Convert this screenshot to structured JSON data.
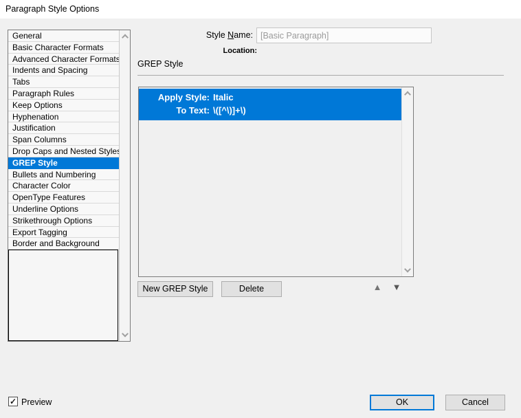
{
  "window": {
    "title": "Paragraph Style Options"
  },
  "colors": {
    "accent": "#0078d7",
    "selection_text": "#ffffff",
    "dialog_bg": "#f0f0f0",
    "titlebar_bg": "#ffffff",
    "button_bg": "#e1e1e1"
  },
  "sidebar": {
    "items": [
      "General",
      "Basic Character Formats",
      "Advanced Character Formats",
      "Indents and Spacing",
      "Tabs",
      "Paragraph Rules",
      "Keep Options",
      "Hyphenation",
      "Justification",
      "Span Columns",
      "Drop Caps and Nested Styles",
      "GREP Style",
      "Bullets and Numbering",
      "Character Color",
      "OpenType Features",
      "Underline Options",
      "Strikethrough Options",
      "Export Tagging",
      "Border and Background"
    ],
    "selected_index": 11
  },
  "header": {
    "style_name_label": {
      "pre": "Style ",
      "mnemonic": "N",
      "post": "ame:"
    },
    "style_name_value": "[Basic Paragraph]",
    "location_label": "Location:"
  },
  "panel": {
    "title": "GREP Style",
    "grep_styles": [
      {
        "selected": true,
        "lines": [
          {
            "label": "Apply Style:",
            "value": "Italic"
          },
          {
            "label": "To Text:",
            "value": "\\([^\\)]+\\)"
          }
        ]
      }
    ],
    "buttons": {
      "new_grep_style": "New GREP Style",
      "delete": "Delete"
    }
  },
  "footer": {
    "preview_label": "Preview",
    "preview_checked": true,
    "ok": "OK",
    "cancel": "Cancel"
  },
  "icons": {
    "move_up": "▲",
    "move_down": "▼",
    "checkmark": "✓"
  }
}
